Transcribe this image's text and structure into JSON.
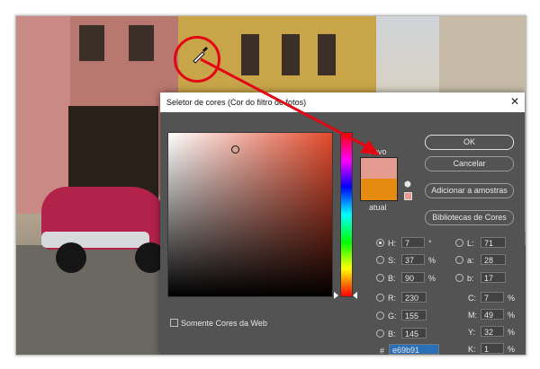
{
  "dialog": {
    "title": "Seletor de cores (Cor do filtro de fotos)",
    "close_glyph": "✕",
    "label_new": "novo",
    "label_current": "atual",
    "web_only_label": "Somente Cores da Web",
    "cube_glyph": "⬢",
    "buttons": {
      "ok": "OK",
      "cancel": "Cancelar",
      "add_swatch": "Adicionar a amostras",
      "libraries": "Bibliotecas de Cores"
    },
    "colors": {
      "new": "#e69b91",
      "current": "#e68a10"
    },
    "hsb": {
      "h": {
        "label": "H:",
        "value": "7",
        "unit": "°"
      },
      "s": {
        "label": "S:",
        "value": "37",
        "unit": "%"
      },
      "b": {
        "label": "B:",
        "value": "90",
        "unit": "%"
      }
    },
    "lab": {
      "l": {
        "label": "L:",
        "value": "71"
      },
      "a": {
        "label": "a:",
        "value": "28"
      },
      "b": {
        "label": "b:",
        "value": "17"
      }
    },
    "rgb": {
      "r": {
        "label": "R:",
        "value": "230"
      },
      "g": {
        "label": "G:",
        "value": "155"
      },
      "b": {
        "label": "B:",
        "value": "145"
      }
    },
    "cmyk": {
      "c": {
        "label": "C:",
        "value": "7",
        "unit": "%"
      },
      "m": {
        "label": "M:",
        "value": "49",
        "unit": "%"
      },
      "y": {
        "label": "Y:",
        "value": "32",
        "unit": "%"
      },
      "k": {
        "label": "K:",
        "value": "1",
        "unit": "%"
      }
    },
    "hex": {
      "label": "#",
      "value": "e69b91"
    }
  },
  "annotation": {
    "color": "#e30613"
  }
}
